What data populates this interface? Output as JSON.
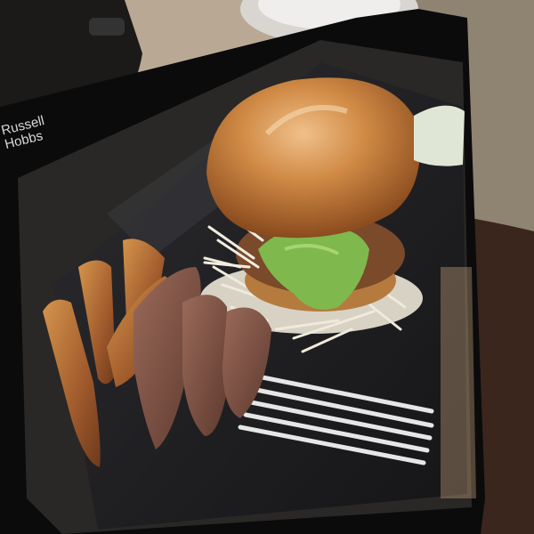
{
  "scene": {
    "description_free": true,
    "brand_text": "Russell\nHobbs",
    "colors": {
      "counter": "#b9a994",
      "kettle": "#1c1a19",
      "phone_bezel": "#0b0b0c",
      "plate": "#1f1f22",
      "bun": "#c7803d",
      "lettuce": "#7fb84d",
      "slaw": "#e9e4d6",
      "wedge": "#a9683a",
      "stripes": "#e6e6e6",
      "hand": "#3a261c"
    }
  }
}
